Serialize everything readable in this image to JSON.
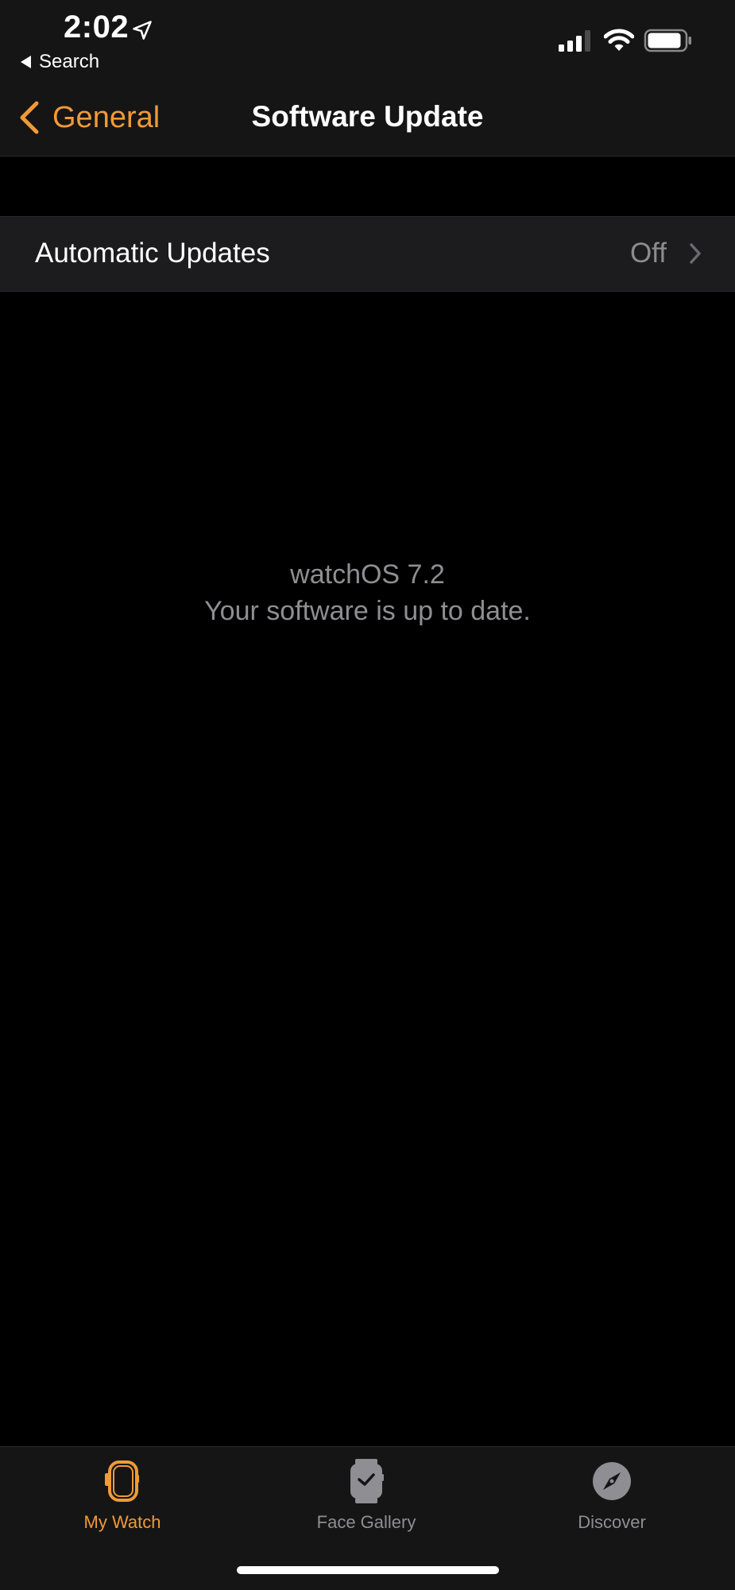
{
  "status_bar": {
    "time": "2:02",
    "back_app_label": "Search"
  },
  "nav": {
    "back_label": "General",
    "title": "Software Update"
  },
  "settings": {
    "automatic_updates": {
      "label": "Automatic Updates",
      "value": "Off"
    }
  },
  "update_status": {
    "version": "watchOS 7.2",
    "message": "Your software is up to date."
  },
  "tab_bar": {
    "tabs": [
      {
        "label": "My Watch",
        "icon": "watch-icon",
        "selected": true
      },
      {
        "label": "Face Gallery",
        "icon": "face-gallery-icon",
        "selected": false
      },
      {
        "label": "Discover",
        "icon": "compass-icon",
        "selected": false
      }
    ]
  },
  "colors": {
    "accent": "#f19a37",
    "background": "#000000",
    "bar_background": "#151515",
    "row_background": "#1c1c1e",
    "secondary_text": "#8e8e93"
  },
  "icons": {
    "location": "location-arrow-icon",
    "signal": "cellular-signal-icon",
    "wifi": "wifi-icon",
    "battery": "battery-icon",
    "back": "chevron-left-icon",
    "disclosure": "chevron-right-icon"
  }
}
